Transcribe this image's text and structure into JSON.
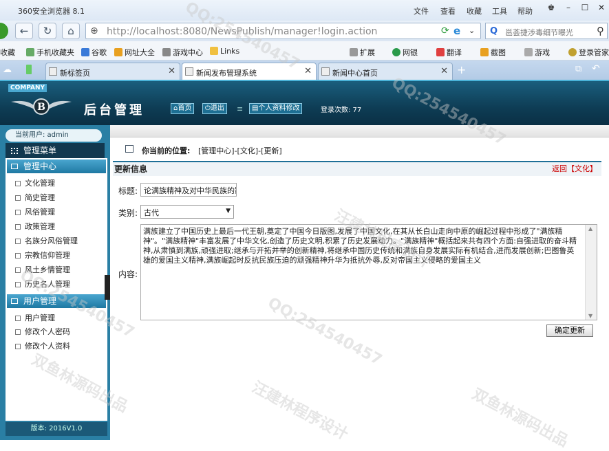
{
  "browser": {
    "title": "360安全浏览器 8.1",
    "menus": [
      "文件",
      "查看",
      "收藏",
      "工具",
      "帮助"
    ],
    "url": "http://localhost:8080/NewsPublish/manager!login.action",
    "search_text": "邕荟捷涉毒细节曝光"
  },
  "bookmarks": [
    "收藏",
    "手机收藏夹",
    "谷歌",
    "网址大全",
    "游戏中心",
    "Links",
    "扩展",
    "网银",
    "翻译",
    "截图",
    "游戏",
    "登录管家"
  ],
  "tabs": [
    {
      "label": "新标签页",
      "active": false
    },
    {
      "label": "新闻发布管理系统",
      "active": true
    },
    {
      "label": "新闻中心首页",
      "active": false
    }
  ],
  "app": {
    "company_badge": "COMPANY",
    "title": "后台管理",
    "nav": {
      "home": "首页",
      "logout": "退出",
      "profile": "个人资料修改"
    },
    "login_count": "登录次数: 77"
  },
  "sidebar": {
    "current_user": "当前用户: admin",
    "menu_title": "管理菜单",
    "groups": [
      {
        "label": "管理中心",
        "items": [
          "文化管理",
          "简史管理",
          "风俗管理",
          "政策管理",
          "名族分风俗管理",
          "宗教信仰管理",
          "风土乡情管理",
          "历史名人管理"
        ]
      },
      {
        "label": "用户管理",
        "items": [
          "用户管理",
          "修改个人密码",
          "修改个人资料"
        ]
      }
    ],
    "version": "版本: 2016V1.0"
  },
  "content": {
    "location_label": "你当前的位置:",
    "location_path": "[管理中心]-[文化]-[更新]",
    "section_title": "更新信息",
    "back_link": "返回【文化】",
    "form": {
      "title_label": "标题:",
      "title_value": "论满族精神及对中华民族的影响",
      "category_label": "类别:",
      "category_value": "古代",
      "content_label": "内容:",
      "content_value": "满族建立了中国历史上最后一代王朝,奠定了中国今日版图,发展了中国文化,在其从长白山走向中原的崛起过程中形成了\"满族精神\"。\"满族精神\"丰富发展了中华文化,创造了历史文明,积累了历史发展动力。\"满族精神\"概括起来共有四个方面:自强进取的奋斗精神,从肃慎到满族,顽强进取;继承与开拓并举的创新精神,将继承中国历史传统和满族自身发展实际有机结合,进而发展创新;巴图鲁英雄的爱国主义精神,满族崛起时反抗民族压迫的顽强精神升华为抵抗外辱,反对帝国主义侵略的爱国主义",
      "submit_label": "确定更新"
    }
  },
  "watermarks": [
    "QQ:254540457",
    "汪建林程序设计",
    "双鱼林源码出品"
  ]
}
